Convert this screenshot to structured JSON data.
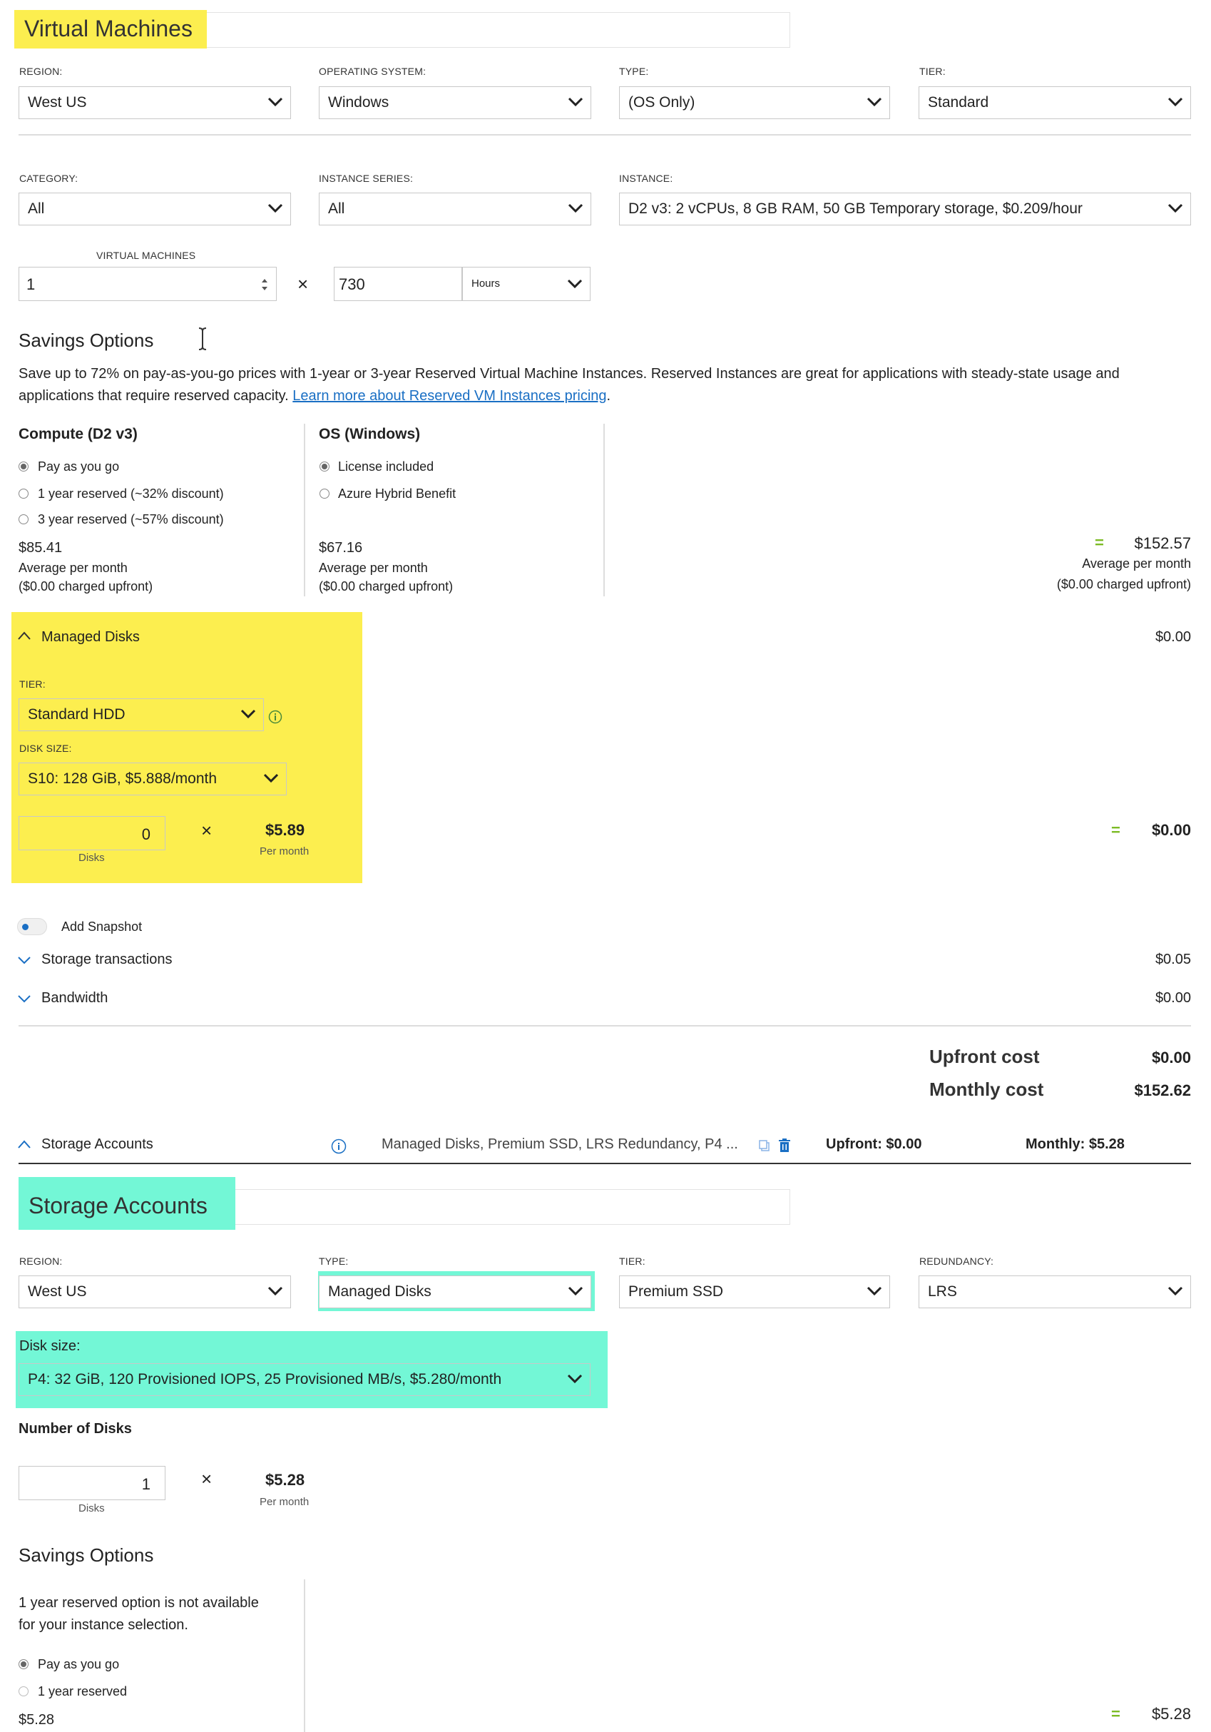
{
  "vm": {
    "title": "Virtual Machines",
    "region_label": "REGION:",
    "region": "West US",
    "os_label": "OPERATING SYSTEM:",
    "os": "Windows",
    "type_label": "TYPE:",
    "type": "(OS Only)",
    "tier_label": "TIER:",
    "tier": "Standard",
    "category_label": "CATEGORY:",
    "category": "All",
    "series_label": "INSTANCE SERIES:",
    "series": "All",
    "instance_label": "INSTANCE:",
    "instance": "D2 v3: 2 vCPUs, 8 GB RAM, 50 GB Temporary storage, $0.209/hour",
    "vm_count_label": "VIRTUAL MACHINES",
    "vm_count": "1",
    "times": "×",
    "hours": "730",
    "hours_unit": "Hours"
  },
  "savings": {
    "title": "Savings Options",
    "desc_line1": "Save up to 72% on pay-as-you-go prices with 1-year or 3-year Reserved Virtual Machine Instances. Reserved Instances are great for applications with steady-state usage and",
    "desc_line2": "applications that require reserved capacity.",
    "link": "Learn more about Reserved VM Instances pricing",
    "period": ".",
    "compute_title": "Compute (D2 v3)",
    "compute_options": [
      "Pay as you go",
      "1 year reserved (~32% discount)",
      "3 year reserved (~57% discount)"
    ],
    "compute_price": "$85.41",
    "compute_avg": "Average per month",
    "compute_upfront": "($0.00 charged upfront)",
    "os_title": "OS (Windows)",
    "os_options": [
      "License included",
      "Azure Hybrid Benefit"
    ],
    "os_price": "$67.16",
    "os_avg": "Average per month",
    "os_upfront": "($0.00 charged upfront)",
    "equals": "=",
    "total": "$152.57",
    "total_avg": "Average per month",
    "total_upfront": "($0.00 charged upfront)"
  },
  "disks": {
    "title": "Managed Disks",
    "total_right": "$0.00",
    "tier_label": "TIER:",
    "tier": "Standard HDD",
    "size_label": "DISK SIZE:",
    "size": "S10: 128 GiB, $5.888/month",
    "count": "0",
    "count_unit": "Disks",
    "times": "×",
    "price": "$5.89",
    "price_unit": "Per month",
    "equals": "=",
    "sum": "$0.00"
  },
  "snapshot": {
    "label": "Add Snapshot"
  },
  "storage_tx": {
    "label": "Storage transactions",
    "value": "$0.05"
  },
  "bandwidth": {
    "label": "Bandwidth",
    "value": "$0.00"
  },
  "costs": {
    "upfront_label": "Upfront cost",
    "upfront": "$0.00",
    "monthly_label": "Monthly cost",
    "monthly": "$152.62"
  },
  "sa_bar": {
    "label": "Storage Accounts",
    "summary": "Managed Disks, Premium SSD, LRS Redundancy, P4 ...",
    "upfront": "Upfront: $0.00",
    "monthly": "Monthly: $5.28"
  },
  "sa": {
    "title": "Storage Accounts",
    "region_label": "REGION:",
    "region": "West US",
    "type_label": "TYPE:",
    "type": "Managed Disks",
    "tier_label": "TIER:",
    "tier": "Premium SSD",
    "redundancy_label": "REDUNDANCY:",
    "redundancy": "LRS",
    "disk_size_label": "Disk size:",
    "disk_size": "P4: 32 GiB, 120 Provisioned IOPS, 25 Provisioned MB/s, $5.280/month",
    "num_disks_label": "Number of Disks",
    "count": "1",
    "count_unit": "Disks",
    "times": "×",
    "price": "$5.28",
    "price_unit": "Per month",
    "savings_title": "Savings Options",
    "note_line1": "1 year reserved option is not available",
    "note_line2": "for your instance selection.",
    "options": [
      "Pay as you go",
      "1 year reserved"
    ],
    "price_bottom": "$5.28",
    "equals": "=",
    "total": "$5.28"
  },
  "colors": {
    "yellow": "#fcee4f",
    "teal": "#73f7d6",
    "green": "#7cbb25",
    "link": "#1a6fc4",
    "blue_icon": "#1a6fc4"
  }
}
